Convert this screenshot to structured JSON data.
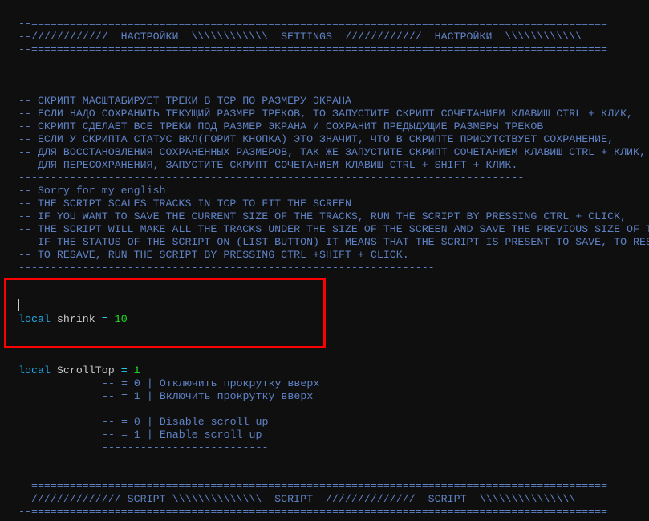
{
  "editor": {
    "header": {
      "border_top": "--==========================================================================================",
      "title": "--////////////  НАСТРОЙКИ  \\\\\\\\\\\\\\\\\\\\\\\\  SETTINGS  ////////////  НАСТРОЙКИ  \\\\\\\\\\\\\\\\\\\\\\\\",
      "border_bottom": "--=========================================================================================="
    },
    "ru_comments": [
      "-- СКРИПТ МАСШТАБИРУЕТ ТРЕКИ В TCP ПО РАЗМЕРУ ЭКРАНА",
      "-- ЕСЛИ НАДО СОХРАНИТЬ ТЕКУЩИЙ РАЗМЕР ТРЕКОВ, ТО ЗАПУСТИТЕ СКРИПТ СОЧЕТАНИЕМ КЛАВИШ CTRL + КЛИК,",
      "-- СКРИПТ СДЕЛАЕТ ВСЕ ТРЕКИ ПОД РАЗМЕР ЭКРАНА И СОХРАНИТ ПРЕДЫДУЩИЕ РАЗМЕРЫ ТРЕКОВ",
      "-- ЕСЛИ У СКРИПТА СТАТУС ВКЛ(ГОРИТ КНОПКА) ЭТО ЗНАЧИТ, ЧТО В СКРИПТЕ ПРИСУТСТВУЕТ СОХРАНЕНИЕ,",
      "-- ДЛЯ ВОССТАНОВЛЕНИЯ СОХРАНЕННЫХ РАЗМЕРОВ, ТАК ЖЕ ЗАПУСТИТЕ СКРИПТ СОЧЕТАНИЕМ КЛАВИШ CTRL + КЛИК,",
      "-- ДЛЯ ПЕРЕСОХРАНЕНИЯ, ЗАПУСТИТЕ СКРИПТ СОЧЕТАНИЕМ КЛАВИШ CTRL + SHIFT + КЛИК.",
      "-------------------------------------------------------------------------------"
    ],
    "en_comments": [
      "-- Sorry for my english",
      "-- THE SCRIPT SCALES TRACKS IN TCP TO FIT THE SCREEN",
      "-- IF YOU WANT TO SAVE THE CURRENT SIZE OF THE TRACKS, RUN THE SCRIPT BY PRESSING CTRL + CLICK,",
      "-- THE SCRIPT WILL MAKE ALL THE TRACKS UNDER THE SIZE OF THE SCREEN AND SAVE THE PREVIOUS SIZE OF T",
      "-- IF THE STATUS OF THE SCRIPT ON (LIST BUTTON) IT MEANS THAT THE SCRIPT IS PRESENT TO SAVE, TO RES",
      "-- TO RESAVE, RUN THE SCRIPT BY PRESSING CTRL +SHIFT + CLICK.",
      "-----------------------------------------------------------------"
    ],
    "shrink": {
      "keyword": "local",
      "name": "shrink",
      "op": "=",
      "value": "10"
    },
    "scrolltop": {
      "keyword": "local",
      "name": "ScrollTop",
      "op": "=",
      "value": "1",
      "comments": [
        "-- = 0 | Отключить прокрутку вверх",
        "-- = 1 | Включить прокрутку вверх",
        "        ------------------------",
        "-- = 0 | Disable scroll up",
        "-- = 1 | Enable scroll up",
        "--------------------------"
      ]
    },
    "footer": {
      "border_top": "--==========================================================================================",
      "title": "--////////////// SCRIPT \\\\\\\\\\\\\\\\\\\\\\\\\\\\  SCRIPT  //////////////  SCRIPT  \\\\\\\\\\\\\\\\\\\\\\\\\\\\\\",
      "border_bottom": "--=========================================================================================="
    }
  }
}
